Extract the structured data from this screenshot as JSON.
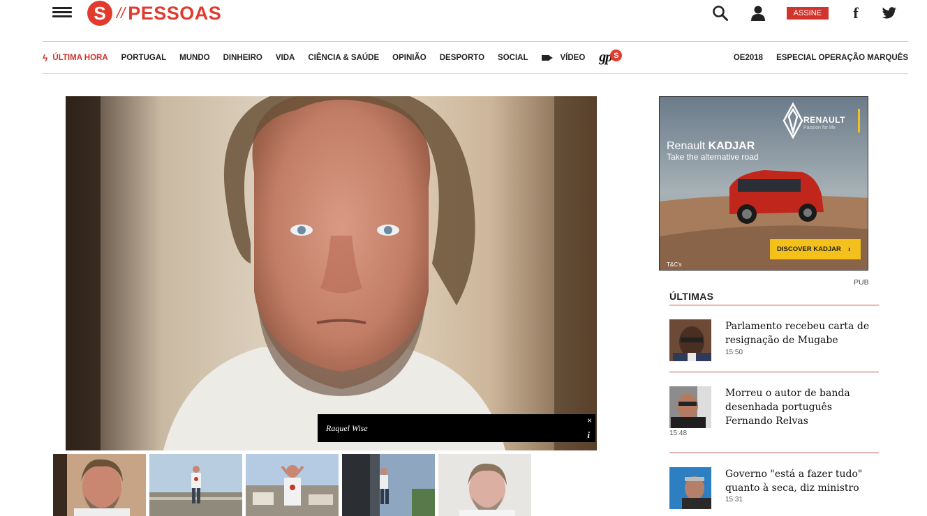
{
  "header": {
    "logo_letter": "S",
    "logo_slashes": "//",
    "logo_text": "PESSOAS",
    "subscribe_label": "ASSINE",
    "icons": [
      "menu-icon",
      "search-icon",
      "user-icon",
      "facebook-icon",
      "twitter-icon"
    ],
    "facebook_glyph": "f"
  },
  "nav": {
    "items": [
      "ÚLTIMA HORA",
      "PORTUGAL",
      "MUNDO",
      "DINHEIRO",
      "VIDA",
      "CIÊNCIA & SAÚDE",
      "OPINIÃO",
      "DESPORTO",
      "SOCIAL",
      "VÍDEO"
    ],
    "gps_text": "gp",
    "gps_badge": "S",
    "right_items": [
      "OE2018",
      "ESPECIAL OPERAÇÃO MARQUÊS"
    ]
  },
  "photo": {
    "caption": "Raquel Wise",
    "close_glyph": "×",
    "info_glyph": "i"
  },
  "ad": {
    "brand": "RENAULT",
    "tagline": "Passion for life",
    "title_light": "Renault",
    "title_bold": "KADJAR",
    "subtitle": "Take the alternative road",
    "cta": "DISCOVER KADJAR",
    "cta_arrow": "›",
    "tc": "T&C's",
    "label": "PUB"
  },
  "ultimas": {
    "title": "ÚLTIMAS",
    "items": [
      {
        "title": "Parlamento recebeu carta de resignação de Mugabe",
        "time": "15:50"
      },
      {
        "title": "Morreu o autor de banda desenhada português Fernando Relvas",
        "time": "15:48"
      },
      {
        "title": "Governo \"está a fazer tudo\" quanto à seca, diz ministro",
        "time": "15:31"
      }
    ]
  },
  "colors": {
    "brand_red": "#e23b2e",
    "subscribe_red": "#d0342c",
    "cta_yellow": "#f3c01c"
  }
}
